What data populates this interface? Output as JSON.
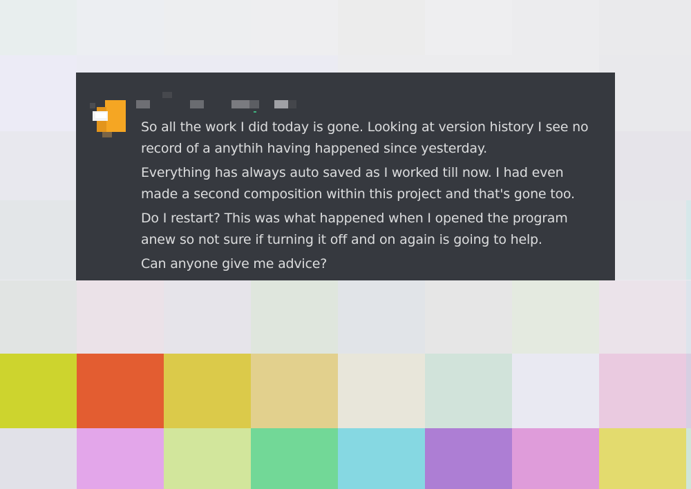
{
  "message": {
    "author_name": "",
    "paragraphs": [
      "So all the work I did today is gone. Looking at version history I see no record of a anythih having happened since yesterday.",
      "Everything has always auto saved as I worked till now. I had even made a second composition within this project and that's gone too.",
      "Do I restart? This was what happened when I opened the program anew so not sure if turning it off and on again is going to help.",
      "Can anyone give me advice?"
    ]
  },
  "colors": {
    "card_background": "#36393f",
    "message_text": "#dcddde",
    "avatar_accent": "#f5a623"
  },
  "icons": {
    "avatar": "avatar-icon"
  }
}
